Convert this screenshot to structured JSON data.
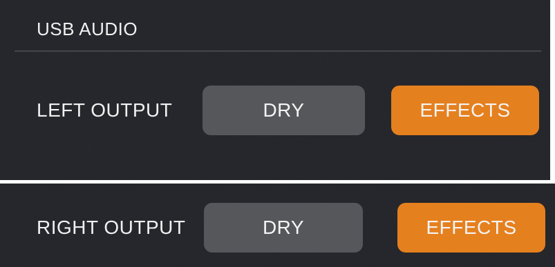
{
  "section": {
    "title": "USB AUDIO"
  },
  "rows": [
    {
      "label": "LEFT OUTPUT",
      "options": [
        "DRY",
        "EFFECTS"
      ],
      "selected": "EFFECTS"
    },
    {
      "label": "RIGHT OUTPUT",
      "options": [
        "DRY",
        "EFFECTS"
      ],
      "selected": "EFFECTS"
    }
  ],
  "colors": {
    "background": "#25262b",
    "button_inactive": "#56575b",
    "button_active": "#e5801f",
    "text": "#f1f1f1"
  }
}
